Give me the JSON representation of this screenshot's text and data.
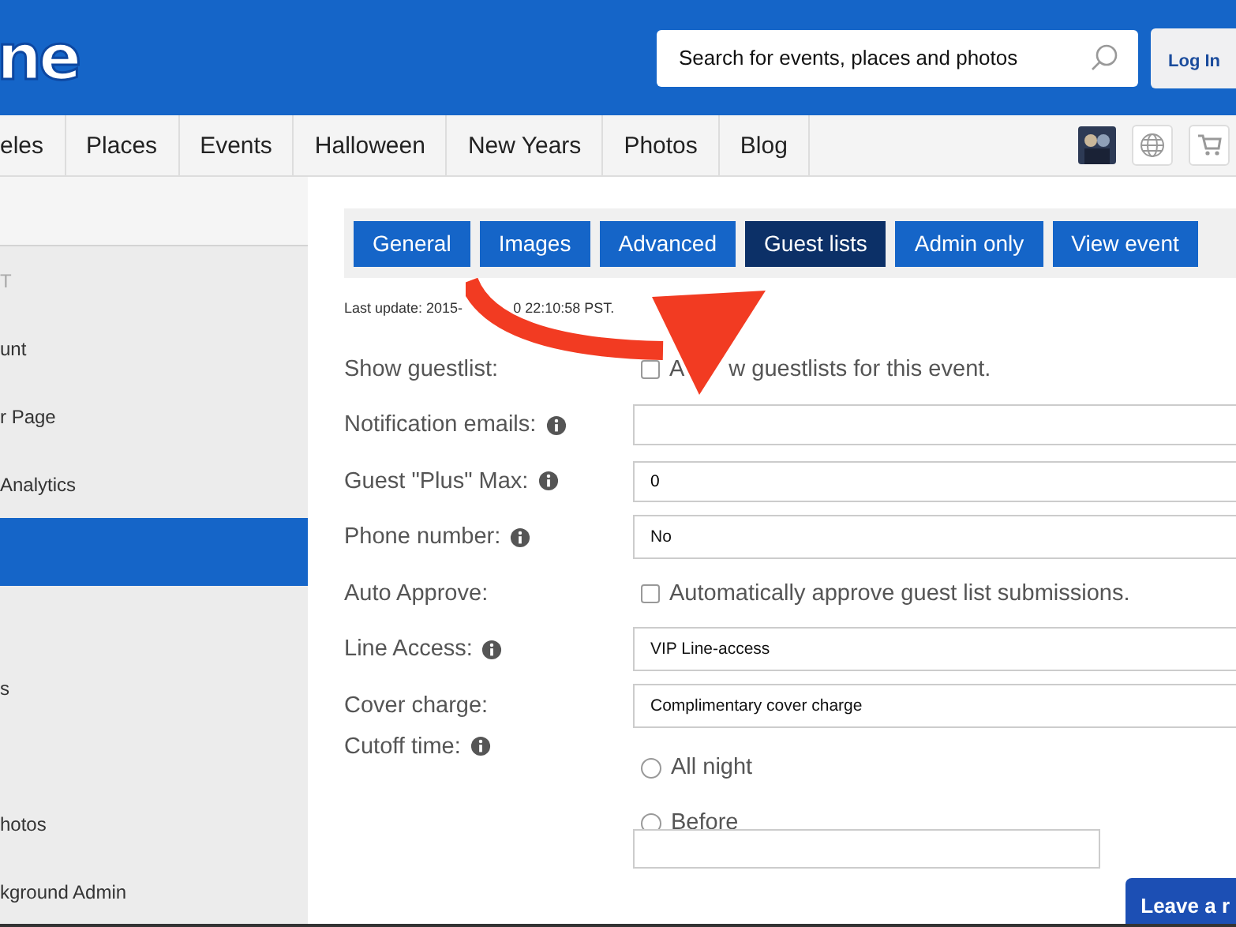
{
  "header": {
    "logo": "ne",
    "search": {
      "placeholder": "Search for events, places and photos"
    },
    "login": "Log In"
  },
  "nav": {
    "items": [
      "eles",
      "Places",
      "Events",
      "Halloween",
      "New Years",
      "Photos",
      "Blog"
    ]
  },
  "sidebar": {
    "items": [
      {
        "kind": "heading",
        "label": "T",
        "selected": false
      },
      {
        "kind": "entry",
        "label": "unt",
        "selected": false
      },
      {
        "kind": "entry",
        "label": "r Page",
        "selected": false
      },
      {
        "kind": "entry",
        "label": "Analytics",
        "selected": false
      },
      {
        "kind": "entry",
        "selected": true
      },
      {
        "kind": "spacer"
      },
      {
        "kind": "entry",
        "label": "s",
        "selected": false
      },
      {
        "kind": "spacer"
      },
      {
        "kind": "entry",
        "label": "hotos",
        "selected": false
      },
      {
        "kind": "entry",
        "label": "kground Admin",
        "selected": false
      }
    ]
  },
  "tabs": [
    {
      "label": "General",
      "selected": false
    },
    {
      "label": "Images",
      "selected": false
    },
    {
      "label": "Advanced",
      "selected": false
    },
    {
      "label": "Guest lists",
      "selected": true
    },
    {
      "label": "Admin only",
      "selected": false
    },
    {
      "label": "View event",
      "selected": false
    }
  ],
  "last_update": [
    "Last update: 2015-",
    "0 22:10:58 PST."
  ],
  "form": [
    {
      "kind": "checkbox",
      "label": "Show guestlist:",
      "checked": false,
      "text_parts": [
        "A",
        "w guestlists for this event."
      ]
    },
    {
      "kind": "input",
      "label": "Notification emails:",
      "info": true
    },
    {
      "kind": "input",
      "label": "Guest \"Plus\" Max:",
      "info": true,
      "value": "0"
    },
    {
      "kind": "select",
      "label": "Phone number:",
      "info": true,
      "value": "No"
    },
    {
      "kind": "checkbox",
      "label": "Auto Approve:",
      "checked": false,
      "text_parts": [
        "Automatically approve guest list submissions."
      ]
    },
    {
      "kind": "select",
      "label": "Line Access:",
      "info": true,
      "value": "VIP Line-access"
    },
    {
      "kind": "select",
      "label": "Cover charge:",
      "value": "Complimentary cover charge"
    },
    {
      "kind": "radios",
      "label": "Cutoff time:",
      "info": true,
      "options": [
        {
          "label": "All night",
          "selected": false
        },
        {
          "label": "Before",
          "selected": false
        }
      ]
    }
  ],
  "feedback_button": "Leave a r"
}
